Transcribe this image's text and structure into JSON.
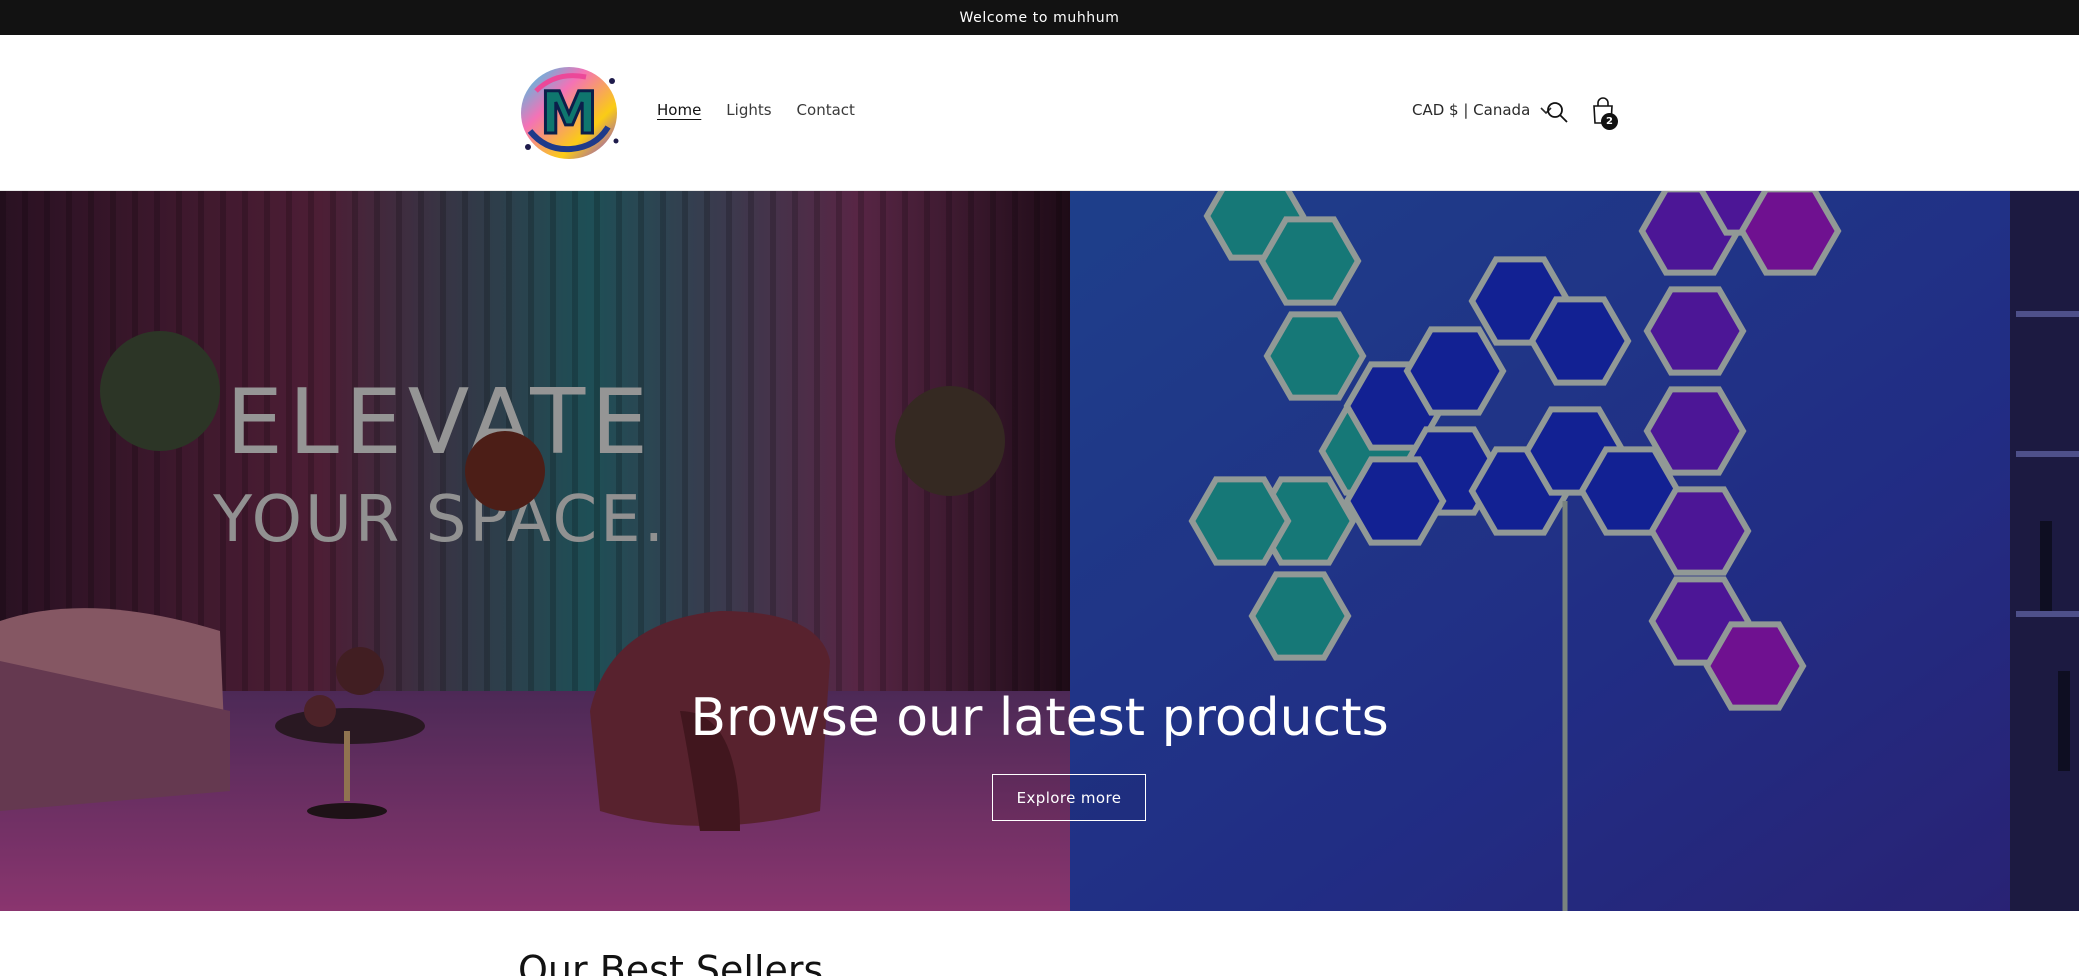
{
  "announcement": {
    "text": "Welcome to muhhum"
  },
  "header": {
    "logo_letter": "M",
    "nav": [
      {
        "label": "Home",
        "active": true
      },
      {
        "label": "Lights",
        "active": false
      },
      {
        "label": "Contact",
        "active": false
      }
    ],
    "locale": "CAD $ | Canada",
    "search_icon": "search-icon",
    "cart_icon": "bag-icon",
    "cart_count": "2"
  },
  "hero": {
    "image_text_line1": "ELEVATE",
    "image_text_line2": "YOUR SPACE.",
    "title": "Browse our latest products",
    "button": "Explore more"
  },
  "section": {
    "title": "Our Best Sellers"
  },
  "colors": {
    "announcement_bg": "#121212",
    "hero_left_tone": "#5a2a4e",
    "hero_right_tone": "#2d3fb8",
    "panel_teal": "#1fa7a6",
    "panel_blue": "#1a2ecc",
    "panel_purple": "#6a1fd0"
  }
}
